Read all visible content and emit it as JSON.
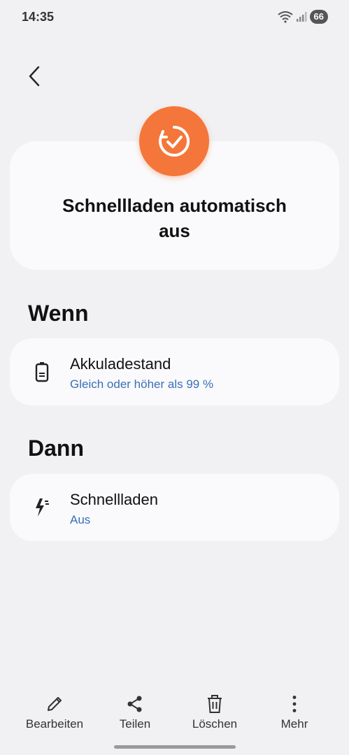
{
  "status": {
    "time": "14:35",
    "battery": "66"
  },
  "routine": {
    "title_line1": "Schnellladen automatisch",
    "title_line2": "aus",
    "accent_color": "#f4763a"
  },
  "if_section": {
    "heading": "Wenn",
    "condition": {
      "title": "Akkuladestand",
      "subtitle": "Gleich oder höher als 99 %",
      "icon": "battery-icon"
    }
  },
  "then_section": {
    "heading": "Dann",
    "action": {
      "title": "Schnellladen",
      "subtitle": "Aus",
      "icon": "fast-charge-icon"
    }
  },
  "bottom_actions": {
    "edit": "Bearbeiten",
    "share": "Teilen",
    "delete": "Löschen",
    "more": "Mehr"
  }
}
